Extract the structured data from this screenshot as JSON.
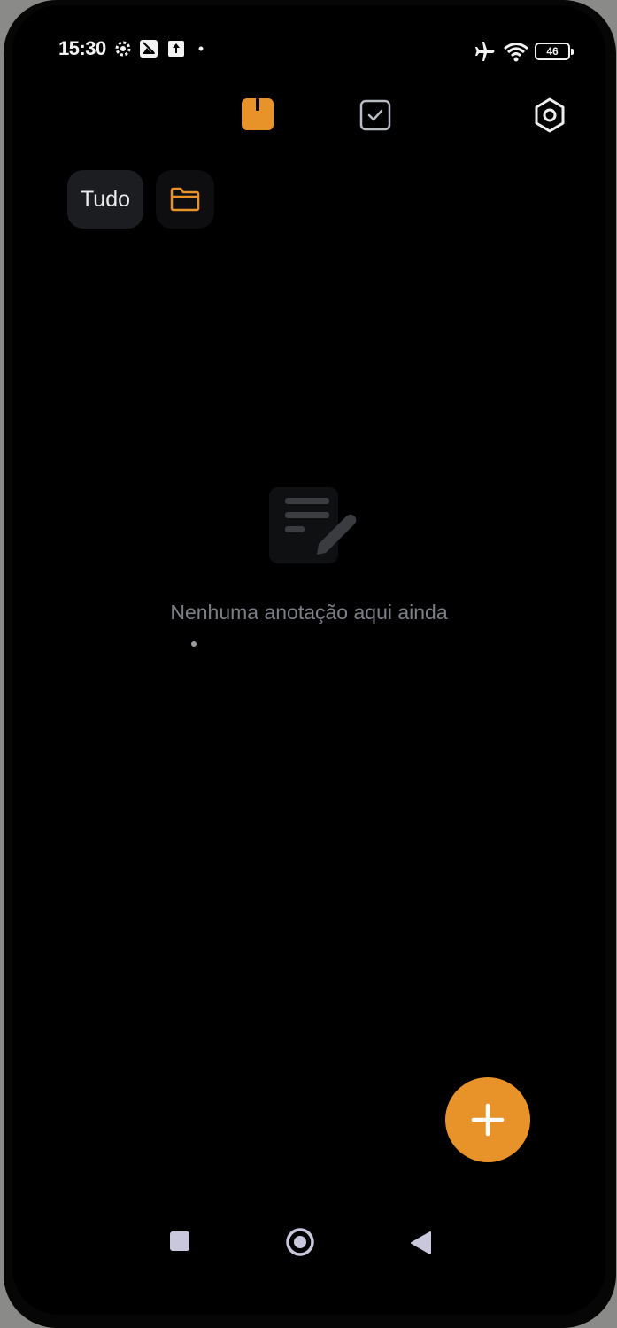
{
  "status_bar": {
    "time": "15:30",
    "battery_level": "46",
    "icons": [
      "settings-gear-icon",
      "photo-icon",
      "upload-icon",
      "dot-icon",
      "airplane-mode-icon",
      "wifi-icon",
      "battery-icon"
    ]
  },
  "toolbar": {
    "tabs": [
      {
        "name": "notes",
        "icon": "note-tab-icon",
        "active": true
      },
      {
        "name": "tasks",
        "icon": "checkbox-tab-icon",
        "active": false
      }
    ],
    "settings_icon": "hexagon-settings-icon"
  },
  "filters": {
    "all_label": "Tudo",
    "folder_icon": "folder-icon"
  },
  "empty_state": {
    "icon": "note-edit-icon",
    "message": "Nenhuma anotação aqui ainda"
  },
  "fab": {
    "icon": "plus-icon"
  },
  "navigation": {
    "buttons": [
      "recents-square-icon",
      "home-circle-icon",
      "back-triangle-icon"
    ]
  },
  "colors": {
    "accent": "#e8922a",
    "background": "#000000",
    "chip": "#1c1d20",
    "muted_text": "#7c7f86"
  }
}
